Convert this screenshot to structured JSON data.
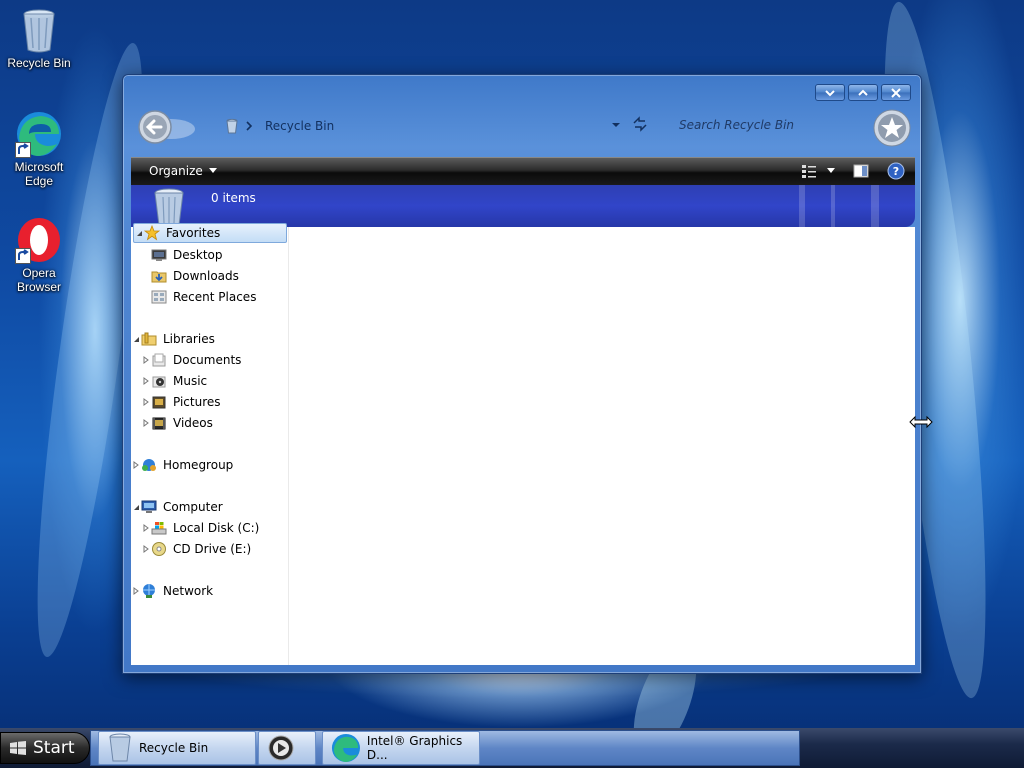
{
  "desktop": {
    "icons": [
      {
        "label": "Recycle Bin",
        "icon": "recycle-bin-icon"
      },
      {
        "label": "Microsoft Edge",
        "icon": "edge-icon"
      },
      {
        "label": "Opera Browser",
        "icon": "opera-icon"
      }
    ]
  },
  "window": {
    "address": {
      "current": "Recycle Bin",
      "icon": "recycle-bin-icon"
    },
    "search_placeholder": "Search Recycle Bin",
    "toolbar": {
      "organize_label": "Organize"
    },
    "banner": {
      "item_count": "0 items"
    },
    "nav": {
      "favorites": "Favorites",
      "desktop": "Desktop",
      "downloads": "Downloads",
      "recent_places": "Recent Places",
      "libraries": "Libraries",
      "documents": "Documents",
      "music": "Music",
      "pictures": "Pictures",
      "videos": "Videos",
      "homegroup": "Homegroup",
      "computer": "Computer",
      "local_disk": "Local Disk (C:)",
      "cd_drive": "CD Drive (E:)",
      "network": "Network"
    }
  },
  "taskbar": {
    "start_label": "Start",
    "tasks": [
      {
        "label": "Recycle Bin",
        "icon": "recycle-bin-icon"
      },
      {
        "label": "",
        "icon": "media-player-icon"
      },
      {
        "label": "Intel® Graphics D...",
        "icon": "edge-icon"
      }
    ]
  },
  "colors": {
    "window_frame": "#4f86d2",
    "toolbar": "#1a1a1a",
    "banner": "#3145c9",
    "selection": "#c4ddf6"
  }
}
